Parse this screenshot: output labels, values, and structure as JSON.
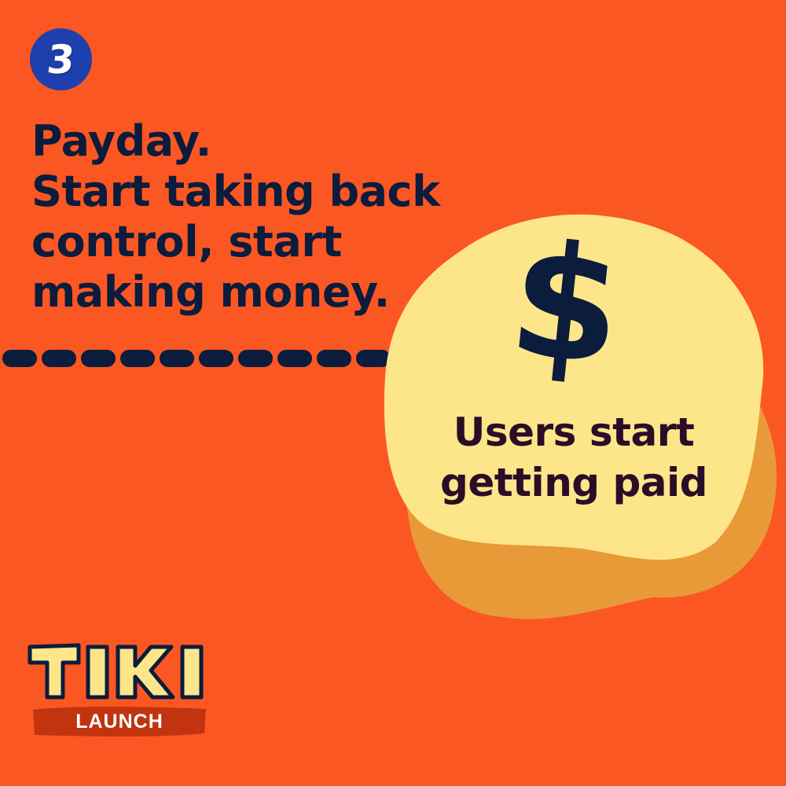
{
  "badge": {
    "number": "3",
    "color": "#1e40af"
  },
  "headline": {
    "lines": [
      "Payday.",
      "Start taking back",
      "control, start",
      "making money."
    ],
    "color": "#0c1c3d"
  },
  "callout": {
    "symbol": "$",
    "lines": [
      "Users start",
      "getting paid"
    ],
    "fill": "#fde68a",
    "shadow": "#e89a38"
  },
  "logo": {
    "wordmark": "TIKI",
    "subtitle": "LAUNCH",
    "banner_color": "#c2330f"
  },
  "colors": {
    "background": "#fb5722",
    "divider": "#0c1c3d"
  }
}
